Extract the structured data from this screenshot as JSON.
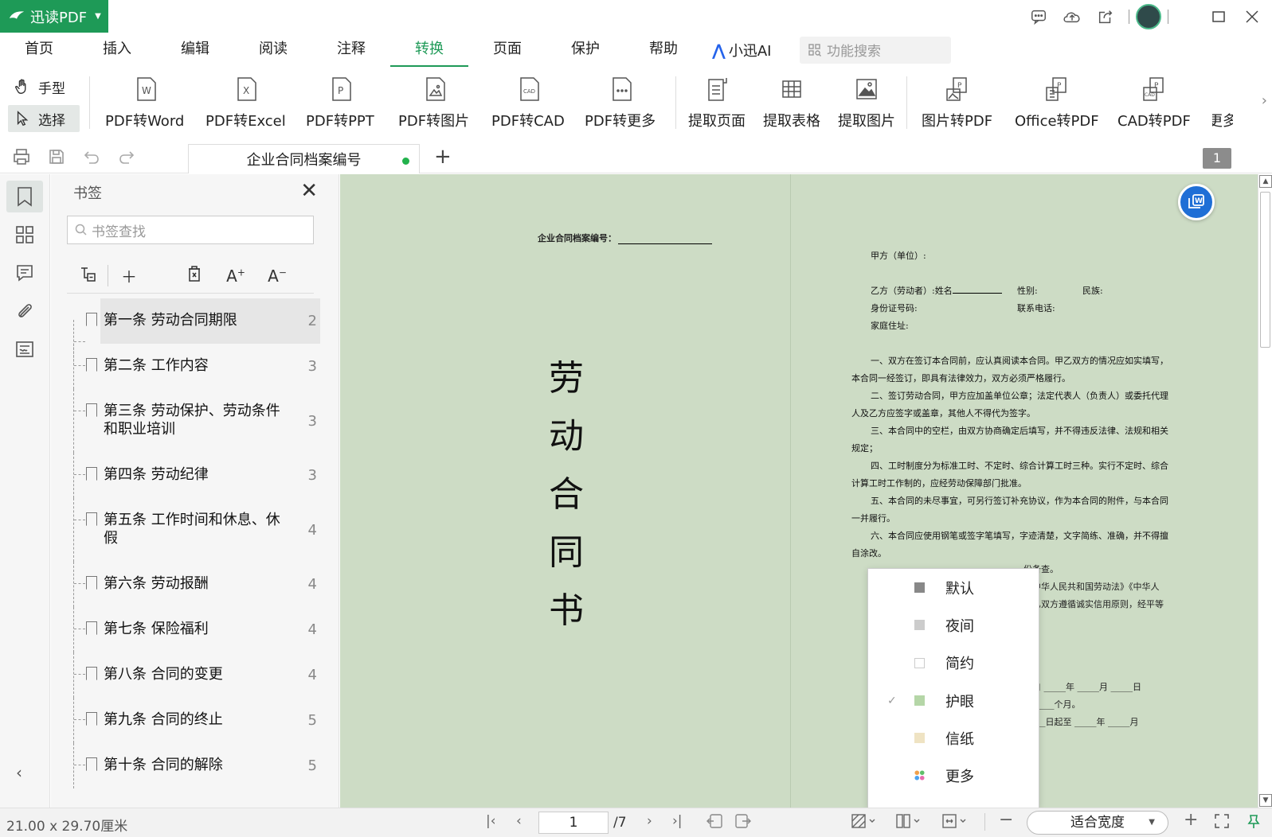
{
  "app": {
    "name": "迅读PDF",
    "accent": "#1e9a57"
  },
  "menu": {
    "items": [
      {
        "label": "首页"
      },
      {
        "label": "插入"
      },
      {
        "label": "编辑"
      },
      {
        "label": "阅读"
      },
      {
        "label": "注释"
      },
      {
        "label": "转换"
      },
      {
        "label": "页面"
      },
      {
        "label": "保护"
      },
      {
        "label": "帮助"
      }
    ],
    "active": "转换",
    "ai_label": "小迅AI",
    "search_placeholder": "功能搜索"
  },
  "ribbon": {
    "hand_label": "手型",
    "select_label": "选择",
    "buttons": [
      {
        "label": "PDF转Word",
        "icon": "pdf-to-word-icon"
      },
      {
        "label": "PDF转Excel",
        "icon": "pdf-to-excel-icon"
      },
      {
        "label": "PDF转PPT",
        "icon": "pdf-to-ppt-icon"
      },
      {
        "label": "PDF转图片",
        "icon": "pdf-to-image-icon"
      },
      {
        "label": "PDF转CAD",
        "icon": "pdf-to-cad-icon"
      },
      {
        "label": "PDF转更多",
        "icon": "pdf-to-more-icon"
      },
      {
        "label": "提取页面",
        "icon": "extract-page-icon"
      },
      {
        "label": "提取表格",
        "icon": "extract-table-icon"
      },
      {
        "label": "提取图片",
        "icon": "extract-image-icon"
      },
      {
        "label": "图片转PDF",
        "icon": "image-to-pdf-icon"
      },
      {
        "label": "Office转PDF",
        "icon": "office-to-pdf-icon"
      },
      {
        "label": "CAD转PDF",
        "icon": "cad-to-pdf-icon"
      },
      {
        "label": "更多",
        "icon": "more-icon"
      }
    ]
  },
  "tabs": {
    "doc_title": "企业合同档案编号",
    "page_badge": "1"
  },
  "bookmarks": {
    "title": "书签",
    "search_placeholder": "书签查找",
    "items": [
      {
        "label": "第一条   劳动合同期限",
        "page": "2"
      },
      {
        "label": "第二条   工作内容",
        "page": "3"
      },
      {
        "label": "第三条   劳动保护、劳动条件和职业培训",
        "page": "3"
      },
      {
        "label": "第四条   劳动纪律",
        "page": "3"
      },
      {
        "label": "第五条   工作时间和休息、休假",
        "page": "4"
      },
      {
        "label": "第六条   劳动报酬",
        "page": "4"
      },
      {
        "label": "第七条   保险福利",
        "page": "4"
      },
      {
        "label": "第八条   合同的变更",
        "page": "4"
      },
      {
        "label": "第九条   合同的终止",
        "page": "5"
      },
      {
        "label": "第十条   合同的解除",
        "page": "5"
      }
    ]
  },
  "document": {
    "page1_header": "企业合同档案编号：",
    "page1_title_chars": [
      "劳",
      "动",
      "合",
      "同",
      "书"
    ],
    "page2": {
      "party_a": "甲方（单位）:",
      "party_b": "乙方（劳动者）:姓名",
      "gender": "性别:",
      "ethnicity": "民族:",
      "id_no": "身份证号码:",
      "phone": "联系电话:",
      "address": "家庭住址:",
      "para1": "一、双方在签订本合同前，应认真阅读本合同。甲乙双方的情况应如实填写，本合同一经签订，即具有法律效力，双方必须严格履行。",
      "para2": "二、签订劳动合同，甲方应加盖单位公章；法定代表人（负责人）或委托代理人及乙方应签字或盖章，其他人不得代为签字。",
      "para3": "三、本合同中的空栏，由双方协商确定后填写，并不得违反法律、法规和相关规定；",
      "para4": "四、工时制度分为标准工时、不定时、综合计算工时三种。实行不定时、综合计算工时工作制的，应经劳动保障部门批准。",
      "para5": "五、本合同的未尽事宜，可另行签订补充协议，作为本合同的附件，与本合同一并履行。",
      "para6": "六、本合同应使用钢笔或签字笔填写，字迹清楚，文字简练、准确，并不得擅自涂改。",
      "frag1": "份备查。",
      "frag2": "《中华人民共和国劳动法》《中华人",
      "frag3": "甲乙双方遵循诚实信用原则，经平等",
      "frag4": "。",
      "frag5": "期自 _____年 _____月 _____日",
      "frag6": "计_____个月。",
      "frag7": "_____日起至 _____年 _____月"
    }
  },
  "theme_menu": {
    "items": [
      {
        "label": "默认",
        "color": "#888888",
        "checked": false
      },
      {
        "label": "夜间",
        "color": "#cccccc",
        "checked": false
      },
      {
        "label": "简约",
        "color": "#ffffff",
        "checked": false
      },
      {
        "label": "护眼",
        "color": "#b5d6a7",
        "checked": true
      },
      {
        "label": "信纸",
        "color": "#efe3c3",
        "checked": false
      },
      {
        "label": "更多",
        "color": "multicolor",
        "checked": false
      }
    ]
  },
  "statusbar": {
    "page_size": "21.00 x 29.70厘米",
    "current_page": "1",
    "total_pages": "/7",
    "zoom": "适合宽度"
  }
}
